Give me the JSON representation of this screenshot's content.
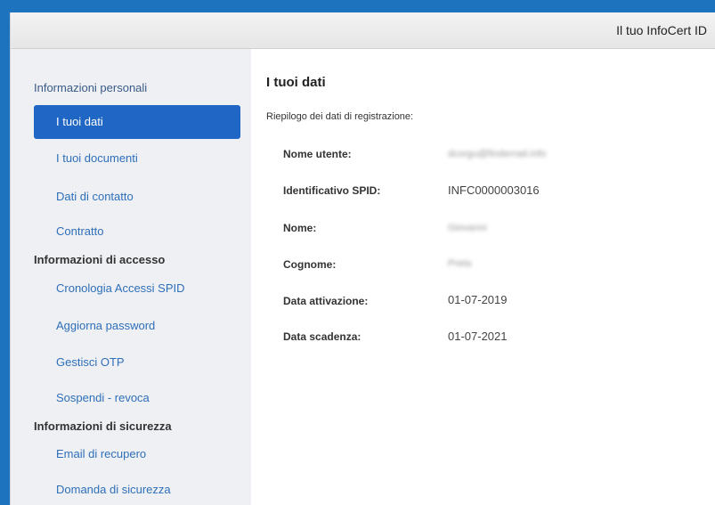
{
  "header": {
    "brand": "Il tuo InfoCert ID"
  },
  "sidebar": {
    "group_personal": "Informazioni personali",
    "items_personal": [
      {
        "label": "I tuoi dati",
        "active": true
      },
      {
        "label": "I tuoi documenti"
      },
      {
        "label": "Dati di contatto"
      },
      {
        "label": "Contratto"
      }
    ],
    "section_access": "Informazioni di accesso",
    "items_access": [
      {
        "label": "Cronologia Accessi SPID"
      },
      {
        "label": "Aggiorna password"
      },
      {
        "label": "Gestisci OTP"
      },
      {
        "label": "Sospendi - revoca"
      }
    ],
    "section_security": "Informazioni di sicurezza",
    "items_security": [
      {
        "label": "Email di recupero"
      },
      {
        "label": "Domanda di sicurezza"
      }
    ]
  },
  "main": {
    "title": "I tuoi dati",
    "subtitle": "Riepilogo dei dati di registrazione:",
    "fields": [
      {
        "label": "Nome utente:",
        "value": "dcorgu@findernail.info"
      },
      {
        "label": "Identificativo SPID:",
        "value": "INFC0000003016"
      },
      {
        "label": "Nome:",
        "value": "Giovanni"
      },
      {
        "label": "Cognome:",
        "value": "Preta"
      },
      {
        "label": "Data attivazione:",
        "value": "01-07-2019"
      },
      {
        "label": "Data scadenza:",
        "value": "01-07-2021"
      }
    ]
  }
}
